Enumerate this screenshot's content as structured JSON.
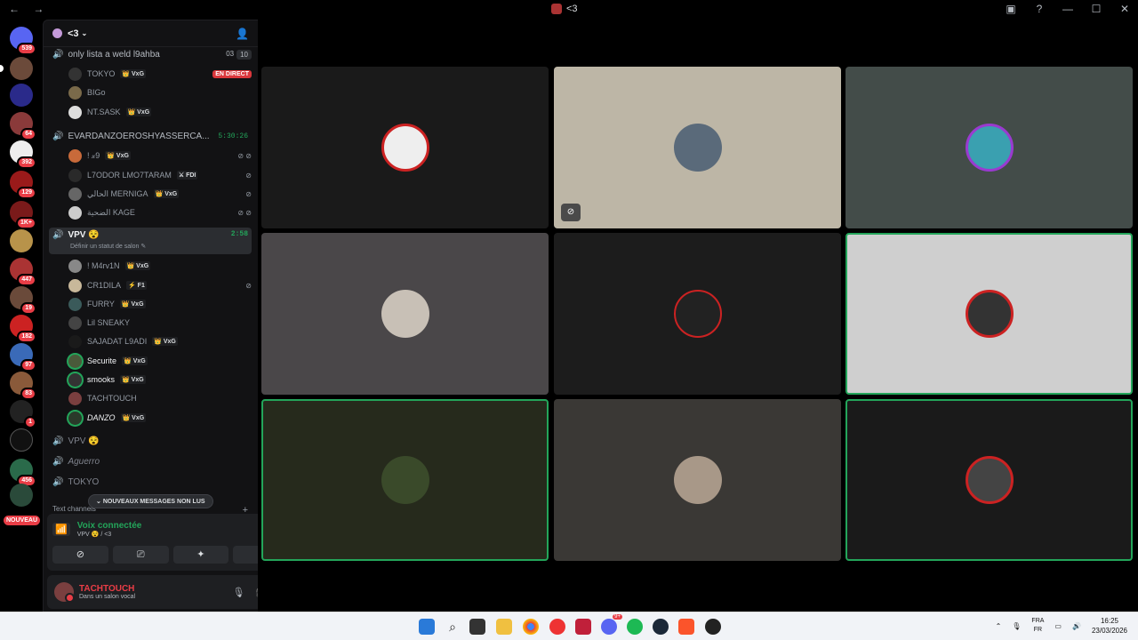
{
  "window": {
    "title": "<3",
    "nav": "← →"
  },
  "guild": {
    "name": "<3"
  },
  "voice_channels": [
    {
      "name": "only lista a weld l9ahba",
      "count_a": "03",
      "count_b": "10",
      "members": [
        {
          "name": "TOKYO",
          "tag": "👑 VxG",
          "live": "EN DIRECT"
        },
        {
          "name": "BIGo"
        },
        {
          "name": "NT.SASK",
          "tag": "👑 VxG"
        }
      ]
    },
    {
      "name": "EVARDANZOEROSHYASSERCA...",
      "time": "5:30:26",
      "members": [
        {
          "name": "! 𝓍9",
          "tag": "👑 VxG",
          "icons": "⊘ ⊘"
        },
        {
          "name": "L7ODOR LMO7TARAM",
          "tag": "⚔ FDI",
          "icons": "⊘"
        },
        {
          "name": "الحالي MERNIGA",
          "tag": "👑 VxG",
          "icons": "⊘"
        },
        {
          "name": "الضحية KAGE",
          "icons": "⊘ ⊘"
        }
      ]
    },
    {
      "name": "VPV 😵",
      "time": "2:58",
      "status": "Définir un statut de salon ✎",
      "members": [
        {
          "name": "! M4rv1N",
          "tag": "👑 VxG"
        },
        {
          "name": "CR1DILA",
          "tag": "⚡ F1",
          "icons": "⊘"
        },
        {
          "name": "FURRY",
          "tag": "👑 VxG"
        },
        {
          "name": "Lil SNEAKY"
        },
        {
          "name": "SAJADAT L9ADI",
          "tag": "👑 VxG"
        },
        {
          "name": "Securite",
          "tag": "👑 VxG"
        },
        {
          "name": "smooks",
          "tag": "👑 VxG"
        },
        {
          "name": "TACHTOUCH"
        },
        {
          "name": "DANZO",
          "tag": "👑 VxG"
        }
      ]
    }
  ],
  "other_channels": [
    "VPV 😵",
    "Aguerro",
    "TOKYO"
  ],
  "text_channels_label": "Text channels",
  "unread_label": "NOUVEAUX MESSAGES NON LUS",
  "connection": {
    "status": "Voix connectée",
    "location": "VPV 😵 / <3"
  },
  "user": {
    "name": "TACHTOUCH",
    "status": "Dans un salon vocal"
  },
  "servers": [
    {
      "badge": "539"
    },
    {
      "badge": ""
    },
    {
      "badge": ""
    },
    {
      "badge": "64"
    },
    {
      "badge": "392"
    },
    {
      "badge": "129"
    },
    {
      "badge": "1K+"
    },
    {
      "badge": ""
    },
    {
      "badge": "447"
    },
    {
      "badge": "19"
    },
    {
      "badge": "182"
    },
    {
      "badge": "97"
    },
    {
      "badge": "83"
    },
    {
      "badge": "1"
    },
    {
      "badge": ""
    },
    {
      "badge": "456"
    }
  ],
  "new_badge": "NOUVEAU",
  "taskbar": {
    "lang_top": "FRA",
    "lang_bottom": "FR",
    "time": "16:25",
    "date": "23/03/2026",
    "discord_badge": "9+"
  }
}
